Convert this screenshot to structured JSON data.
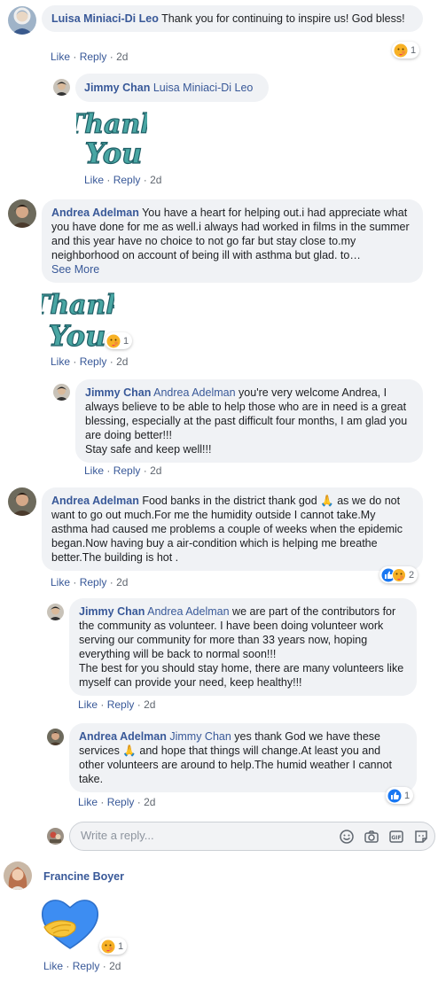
{
  "actions": {
    "like": "Like",
    "reply": "Reply",
    "sep": "·",
    "time": "2d"
  },
  "reply_box": {
    "placeholder": "Write a reply..."
  },
  "c1": {
    "author": "Luisa Miniaci-Di Leo",
    "text": " Thank you for continuing to inspire us! God bless!",
    "reaction_count": "1"
  },
  "c2": {
    "author": "Jimmy Chan",
    "mention": " Luisa Miniaci-Di Leo",
    "sticker": "Thank You"
  },
  "c3": {
    "author": "Andrea Adelman",
    "text": " You have a heart for helping out.i had appreciate what you have done for me as well.i always had worked in films in the summer and this year have no choice to not go far but stay close to.my neighborhood on account of being ill with asthma but glad. to…",
    "see_more": "See More",
    "sticker": "Thank You",
    "reaction_count": "1"
  },
  "c4": {
    "author": "Jimmy Chan",
    "mention": " Andrea Adelman",
    "text": " you're very welcome Andrea, I always believe to be able to help those who are in need is a great blessing, especially at the past difficult four months, I am glad you are doing better!!!\nStay safe and keep well!!!"
  },
  "c5": {
    "author": "Andrea Adelman",
    "text_a": " Food banks in the district thank god ",
    "emoji": "🙏",
    "text_b": " as we do not want to go out much.For me the humidity outside I cannot take.My asthma had caused me problems a couple of weeks when the epidemic began.Now having buy a air-condition which is helping me breathe better.The building is hot .",
    "reaction_count": "2"
  },
  "c6": {
    "author": "Jimmy Chan",
    "mention": " Andrea Adelman",
    "text": " we are part of the contributors for the community as volunteer. I have been doing volunteer work serving our community for more than 33 years now, hoping everything will be back to normal soon!!!\nThe best for you should stay home, there are many volunteers like myself can provide your need, keep healthy!!!"
  },
  "c7": {
    "author": "Andrea Adelman",
    "mention": " Jimmy Chan",
    "text_a": " yes thank God we have these services ",
    "emoji": "🙏",
    "text_b": " and hope that things will change.At least you and other volunteers are around to help.The humid weather I cannot take.",
    "reaction_count": "1"
  },
  "c8": {
    "author": "Francine Boyer",
    "reaction_count": "1"
  },
  "colors": {
    "link": "#385898",
    "bubble": "#f0f2f5",
    "like_blue": "#1877f2"
  }
}
